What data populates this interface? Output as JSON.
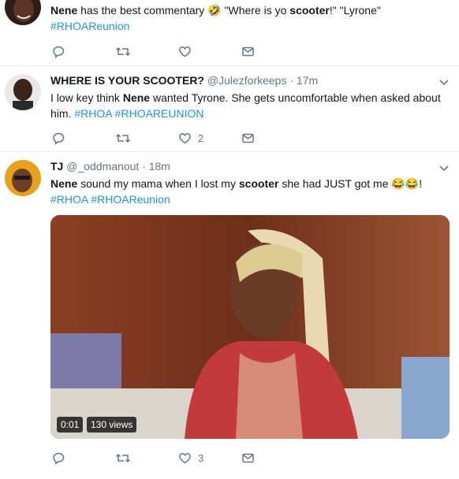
{
  "tweets": [
    {
      "name": "",
      "handle": "",
      "time": "",
      "text_parts": [
        {
          "t": "Nene",
          "bold": true
        },
        {
          "t": " has the best commentary 🤣 \"Where is yo "
        },
        {
          "t": "scooter",
          "bold": true
        },
        {
          "t": "!\" \"Lyrone\""
        }
      ],
      "hashtags": "#RHOAReunion",
      "likes": ""
    },
    {
      "name": "WHERE IS YOUR SCOOTER?",
      "handle": "@Julezforkeeps",
      "time": "· 17m",
      "text_parts": [
        {
          "t": "I low key think "
        },
        {
          "t": "Nene",
          "bold": true
        },
        {
          "t": " wanted Tyrone. She gets uncomfortable when asked about him. "
        }
      ],
      "hashtags": "#RHOA #RHOAREUNION",
      "likes": "2"
    },
    {
      "name": "TJ",
      "handle": "@_oddmanout",
      "time": "· 18m",
      "text_parts": [
        {
          "t": "Nene",
          "bold": true
        },
        {
          "t": " sound my mama when I lost my "
        },
        {
          "t": "scooter",
          "bold": true
        },
        {
          "t": " she had JUST got me 😂😂!"
        }
      ],
      "hashtags": "#RHOA #RHOAReunion",
      "likes": "3",
      "video": {
        "time": "0:01",
        "views": "130 views"
      }
    }
  ],
  "icons": [
    "reply-icon",
    "retweet-icon",
    "like-icon",
    "dm-icon",
    "chevron-down-icon"
  ],
  "colors": {
    "link": "#1b95e0",
    "muted": "#657786",
    "divider": "#e6ecf0"
  }
}
